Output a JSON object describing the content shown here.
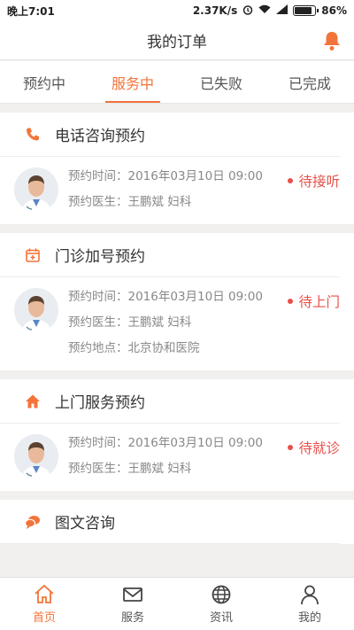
{
  "status_bar": {
    "time": "晚上7:01",
    "speed": "2.37K/s",
    "battery": "86%",
    "battery_level": 0.86
  },
  "header": {
    "title": "我的订单"
  },
  "tabs": [
    {
      "label": "预约中"
    },
    {
      "label": "服务中"
    },
    {
      "label": "已失败"
    },
    {
      "label": "已完成"
    }
  ],
  "cards": [
    {
      "title": "电话咨询预约",
      "icon": "phone-icon",
      "status": "待接听",
      "lines": [
        "预约时间：2016年03月10日 09:00",
        "预约医生：王鹏斌 妇科"
      ]
    },
    {
      "title": "门诊加号预约",
      "icon": "calendar-plus-icon",
      "status": "待上门",
      "lines": [
        "预约时间：2016年03月10日 09:00",
        "预约医生：王鹏斌 妇科",
        "预约地点：北京协和医院"
      ]
    },
    {
      "title": "上门服务预约",
      "icon": "home-icon",
      "status": "待就诊",
      "lines": [
        "预约时间：2016年03月10日 09:00",
        "预约医生：王鹏斌 妇科"
      ]
    },
    {
      "title": "图文咨询",
      "icon": "chat-icon"
    }
  ],
  "nav": [
    {
      "label": "首页",
      "icon": "home-icon"
    },
    {
      "label": "服务",
      "icon": "mail-icon"
    },
    {
      "label": "资讯",
      "icon": "globe-icon"
    },
    {
      "label": "我的",
      "icon": "user-icon"
    }
  ],
  "colors": {
    "accent": "#f2743a",
    "status_red": "#e8504a"
  }
}
